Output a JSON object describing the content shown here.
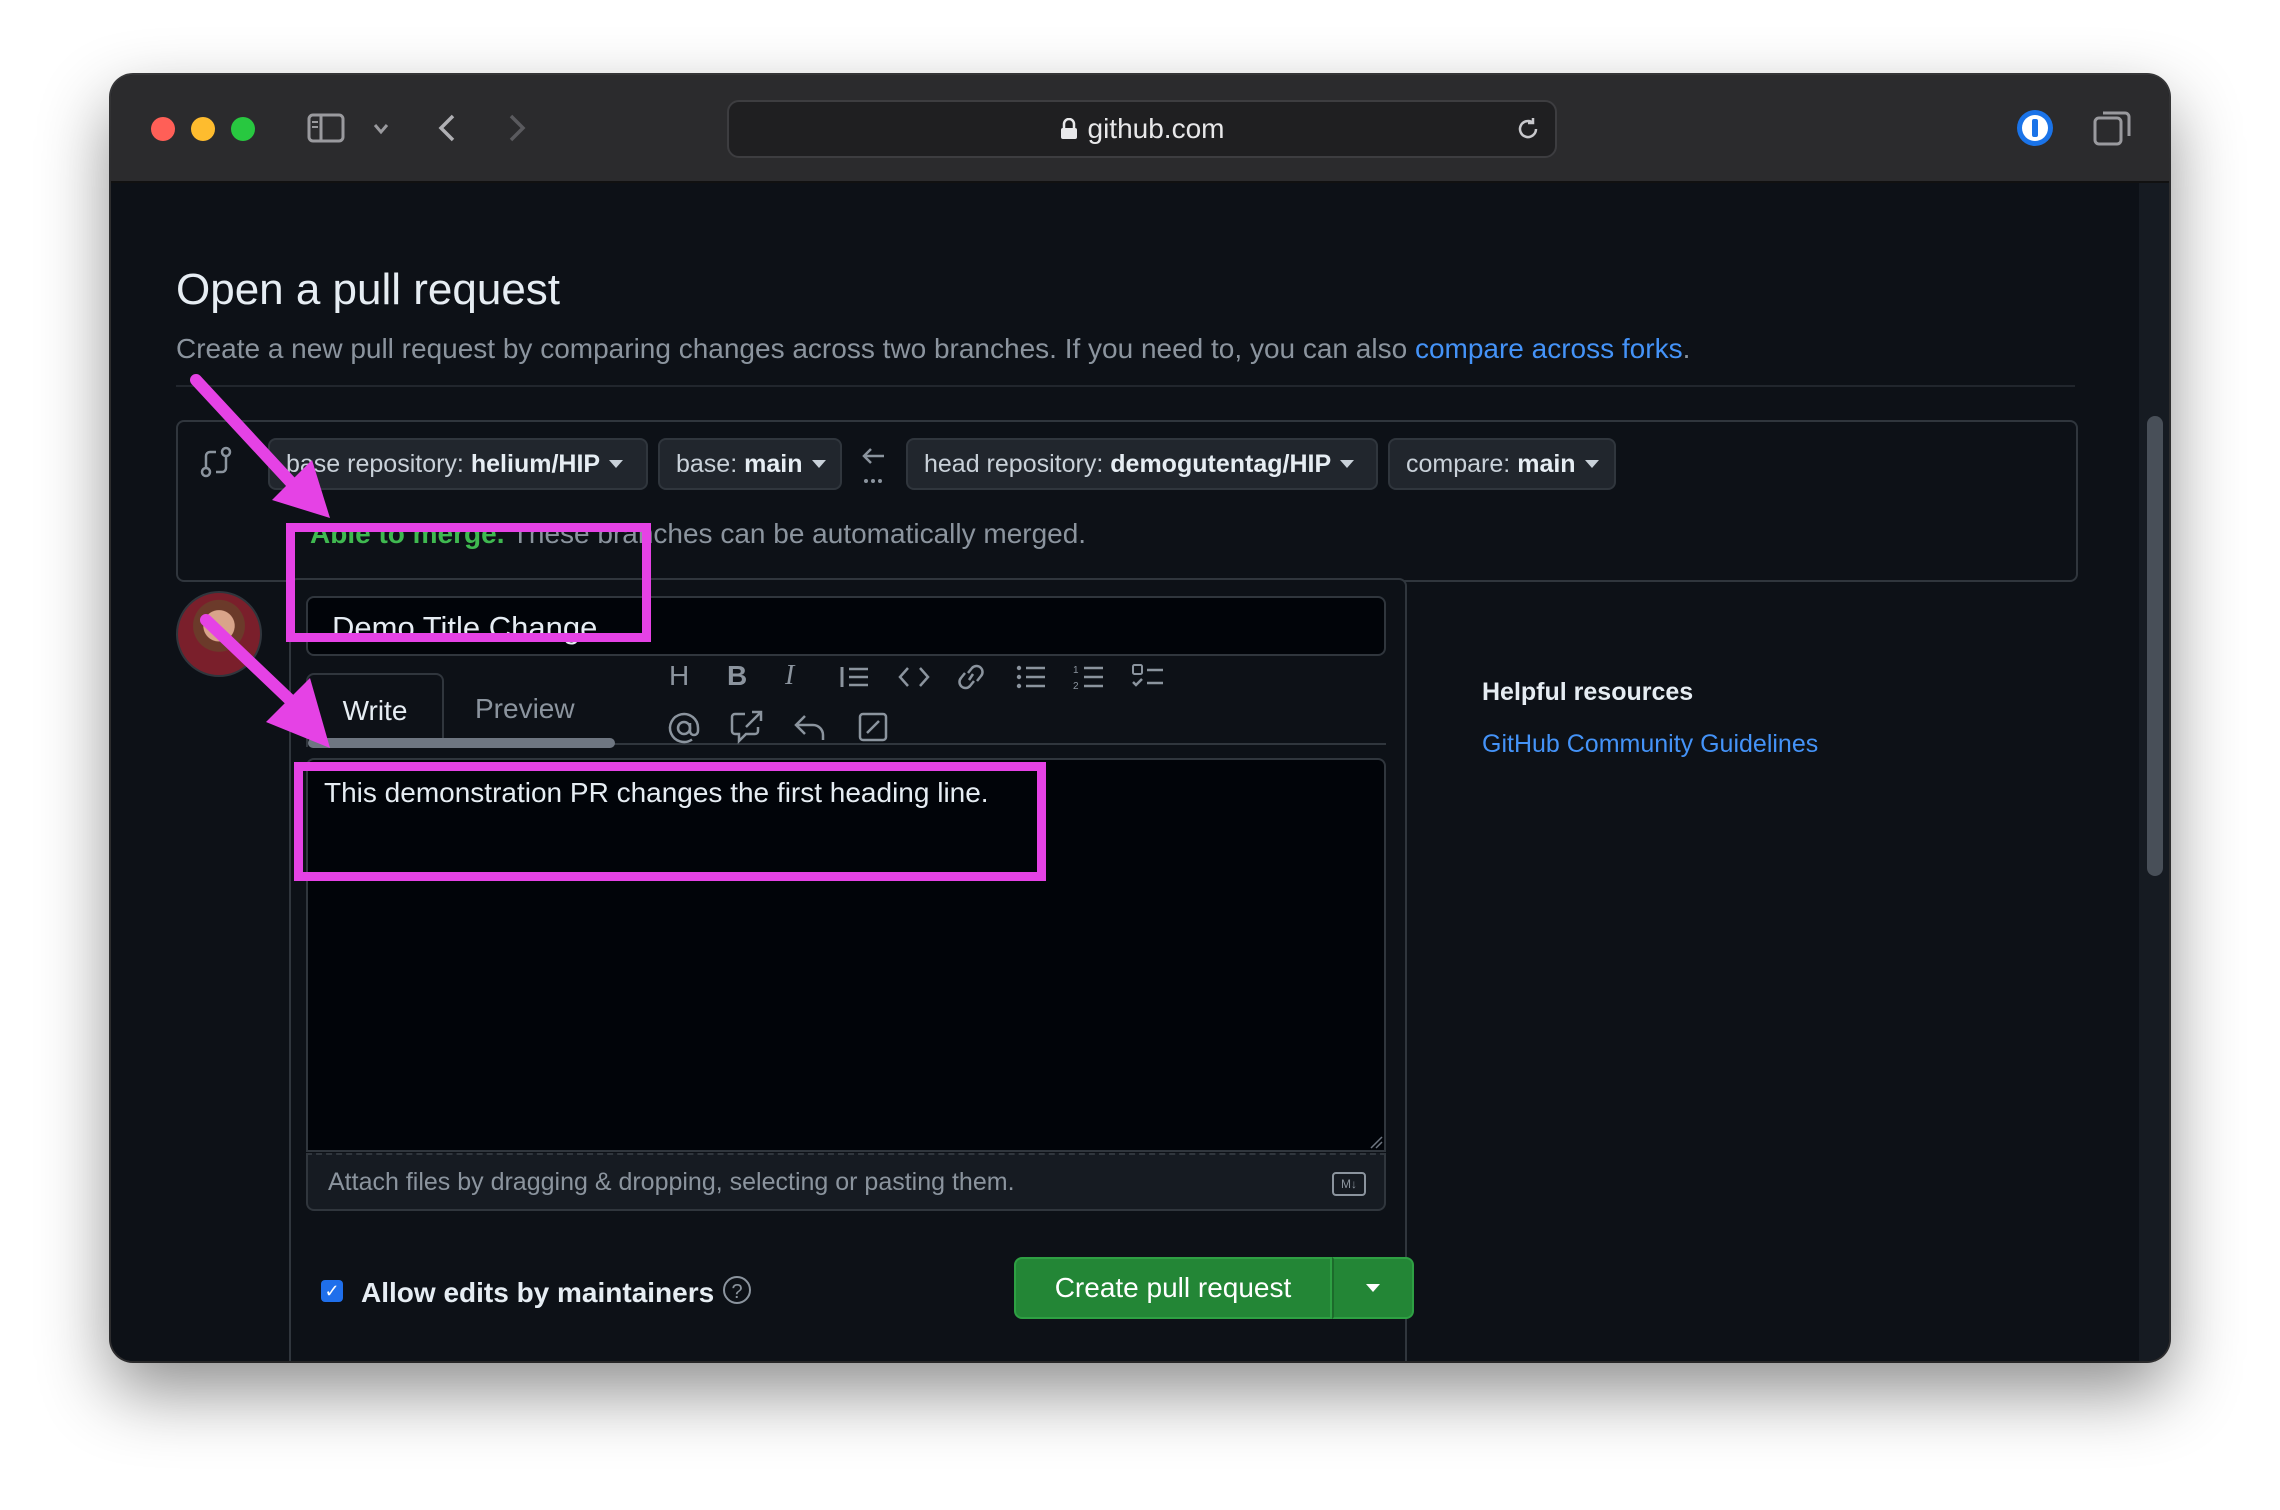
{
  "browser": {
    "url": "github.com"
  },
  "page": {
    "title": "Open a pull request",
    "subtitle_prefix": "Create a new pull request by comparing changes across two branches. If you need to, you can also ",
    "subtitle_link": "compare across forks",
    "subtitle_suffix": "."
  },
  "compare": {
    "base_repo_label": "base repository:",
    "base_repo_value": "helium/HIP",
    "base_label": "base:",
    "base_value": "main",
    "head_repo_label": "head repository:",
    "head_repo_value": "demogutentag/HIP",
    "compare_label": "compare:",
    "compare_value": "main",
    "merge_status": "Able to merge.",
    "merge_message": "These branches can be automatically merged."
  },
  "form": {
    "title_value": "Demo Title Change",
    "tab_write": "Write",
    "tab_preview": "Preview",
    "body_value": "This demonstration PR changes the first heading line.",
    "attach_hint": "Attach files by dragging & dropping, selecting or pasting them.",
    "markdown_badge": "M↓",
    "allow_edits_label": "Allow edits by maintainers",
    "allow_edits_checked": true,
    "create_button": "Create pull request"
  },
  "sidebar": {
    "heading": "Helpful resources",
    "link": "GitHub Community Guidelines"
  },
  "toolbar_icons": [
    "heading-icon",
    "bold-icon",
    "italic-icon",
    "quote-icon",
    "code-icon",
    "link-icon",
    "unordered-list-icon",
    "ordered-list-icon",
    "task-list-icon",
    "mention-icon",
    "reference-icon",
    "reply-icon",
    "slash-command-icon"
  ],
  "colors": {
    "annotation": "#e542e5",
    "accent_link": "#4493f8",
    "success": "#3fb950",
    "create_button": "#238636"
  }
}
